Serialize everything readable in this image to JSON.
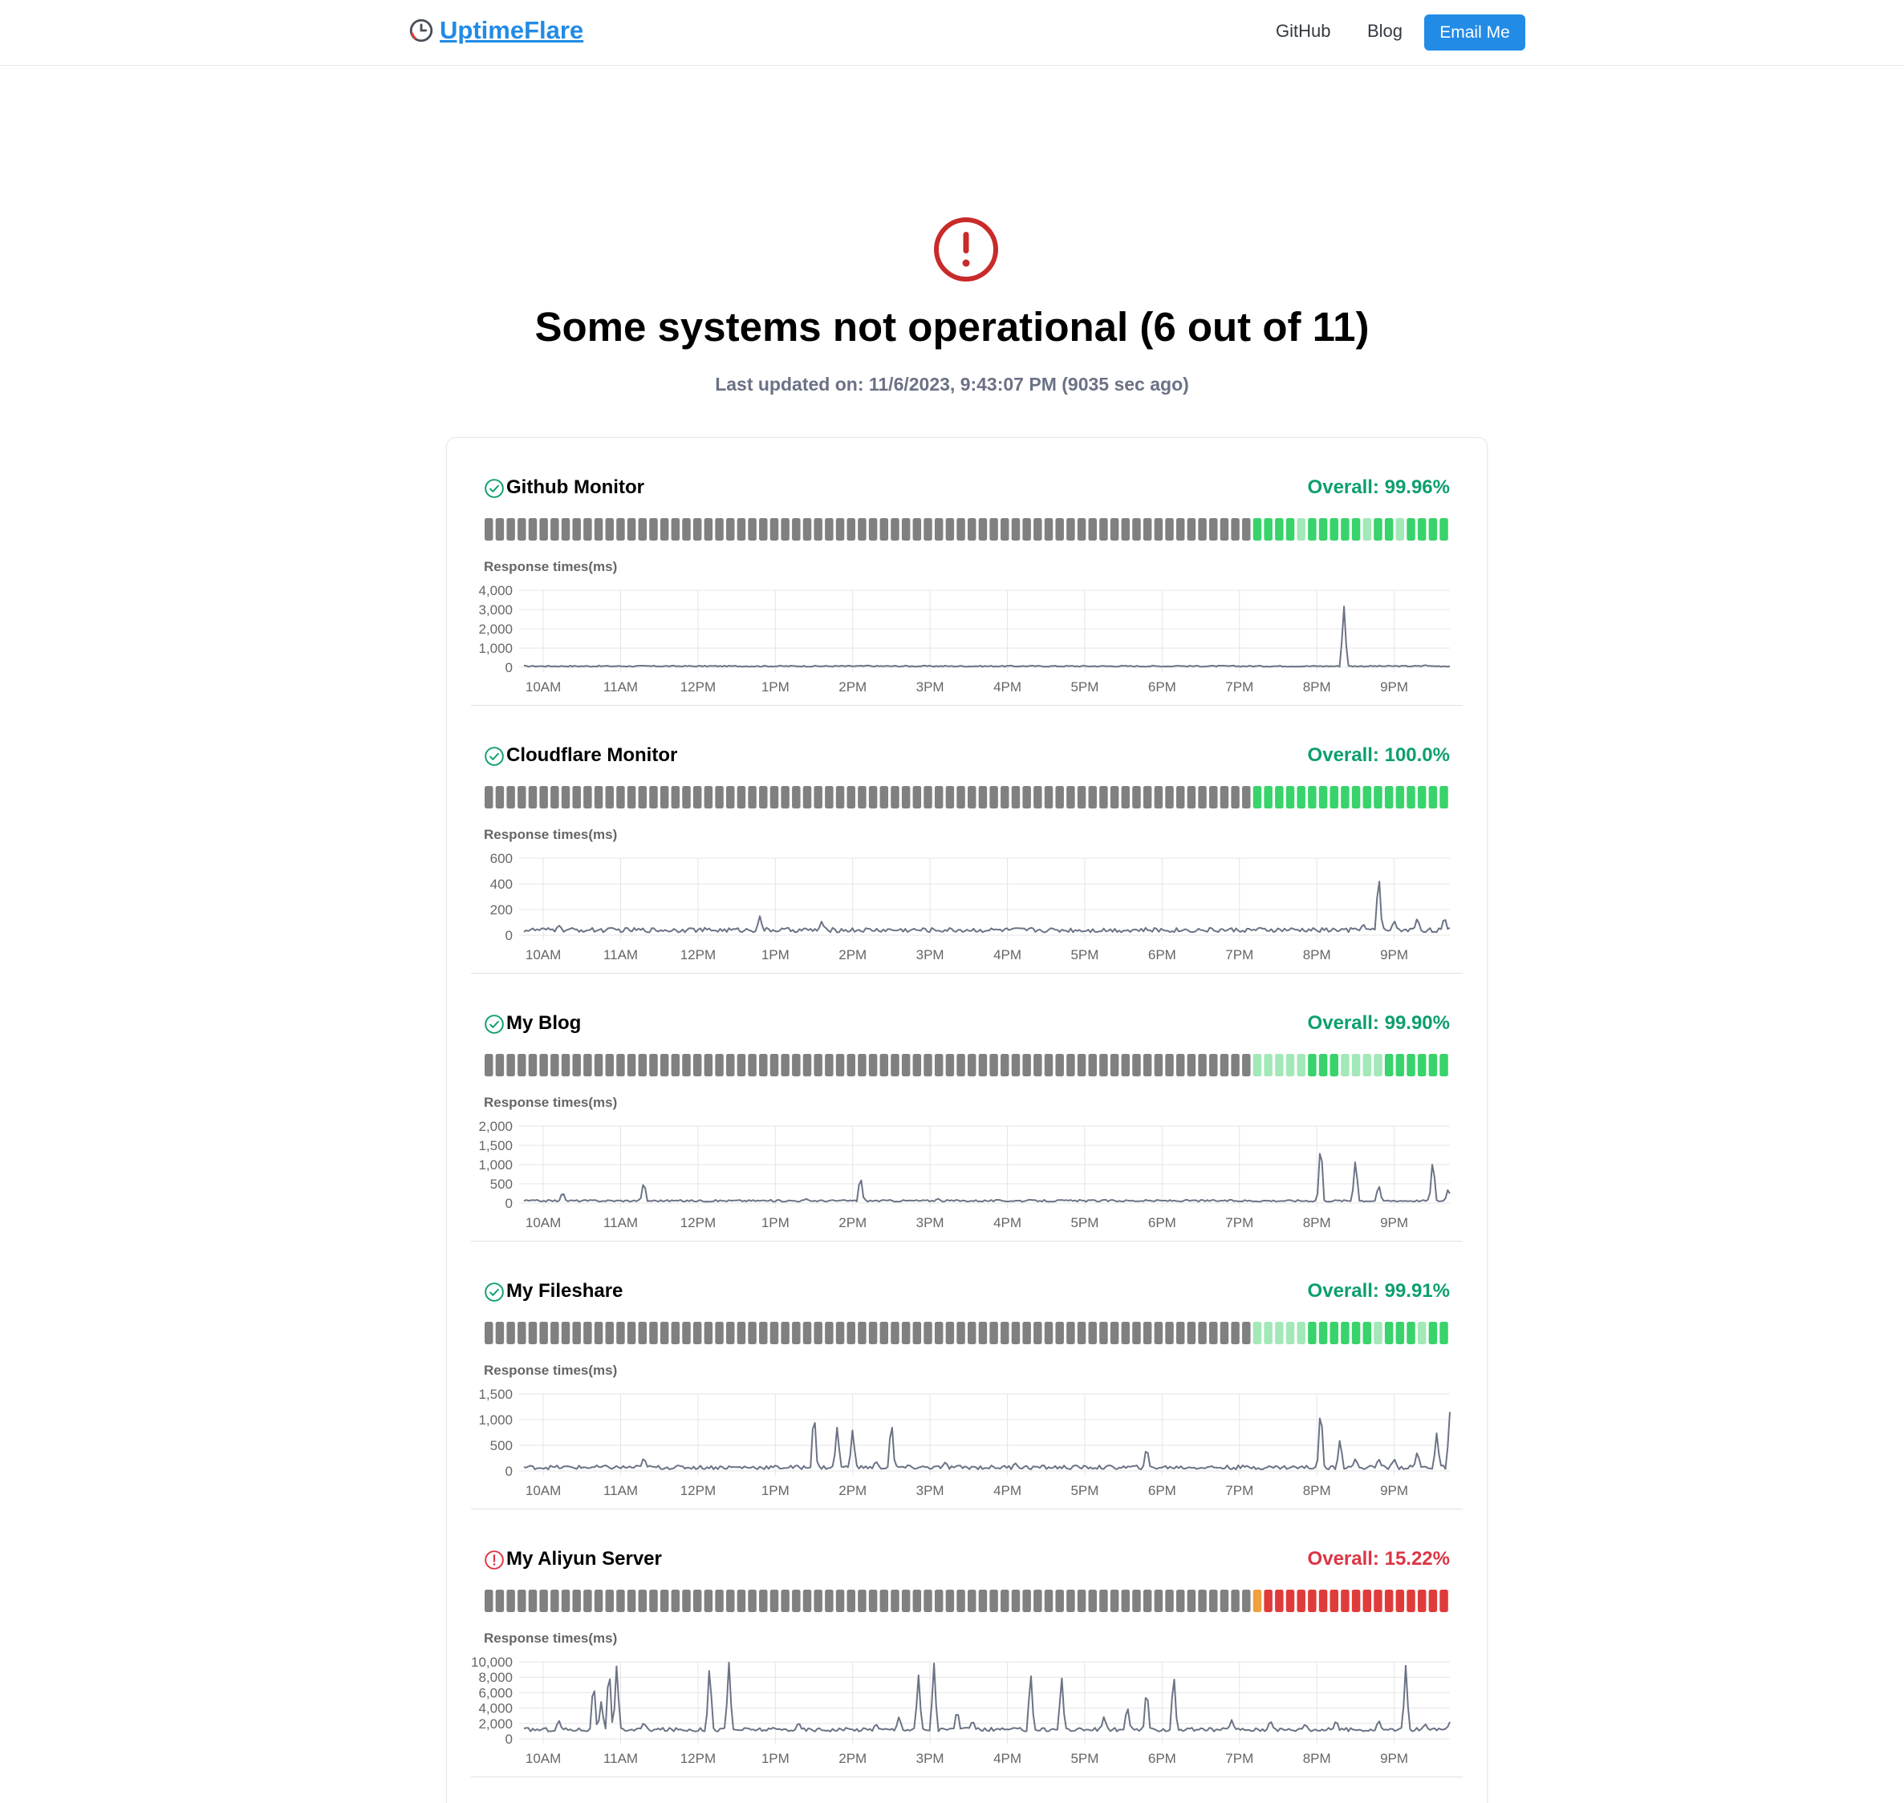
{
  "header": {
    "logo_text": "UptimeFlare",
    "nav_github": "GitHub",
    "nav_blog": "Blog",
    "nav_email": "Email Me"
  },
  "hero": {
    "title": "Some systems not operational (6 out of 11)",
    "subtitle": "Last updated on: 11/6/2023, 9:43:07 PM (9035 sec ago)"
  },
  "colors": {
    "link_blue": "#228be6",
    "ok_green": "#0d9f6e",
    "error_red": "#dc3545",
    "bar_grey": "#808080",
    "bar_green": "#38d36b",
    "bar_light_green": "#a3e8b8",
    "bar_orange": "#f0a03c",
    "bar_red": "#e03b3b",
    "line": "#6b7385"
  },
  "monitors": [
    {
      "name": "Github Monitor",
      "status": "up",
      "overall": "Overall: 99.96%",
      "bars": "GGGGGGGGGGGGGGGGGGGGGGGGGGGGGGGGGGGGGGGGGGGGGGGGGGGGGGGGGGGGGGGGGGGGGGGGGGGGGGGGGGGGGGGGGGGGGGGGGGGGGGGGGGGGGGGGGGGGGGGGGGGGGGGGGGGGGGGGGGGGGGGGGGGGGGGGGGGGGGGGGGGGGGGGGGGGGGGGGGGGGGGGGGGGGGGGGGG",
      "bar_states": [
        "g",
        "g",
        "g",
        "g",
        "g",
        "g",
        "g",
        "g",
        "g",
        "g",
        "g",
        "g",
        "g",
        "g",
        "g",
        "g",
        "g",
        "g",
        "g",
        "g",
        "g",
        "g",
        "g",
        "g",
        "g",
        "g",
        "g",
        "g",
        "g",
        "g",
        "g",
        "g",
        "g",
        "g",
        "g",
        "g",
        "g",
        "g",
        "g",
        "g",
        "g",
        "g",
        "g",
        "g",
        "g",
        "g",
        "g",
        "g",
        "g",
        "g",
        "g",
        "g",
        "g",
        "g",
        "g",
        "g",
        "g",
        "g",
        "g",
        "g",
        "g",
        "g",
        "g",
        "g",
        "g",
        "g",
        "g",
        "g",
        "g",
        "g",
        "G",
        "G",
        "G",
        "G",
        "L",
        "G",
        "G",
        "G",
        "G",
        "G",
        "L",
        "G",
        "G",
        "L",
        "G",
        "G",
        "G",
        "G"
      ],
      "chart_data": {
        "type": "line",
        "title": "Response times(ms)",
        "y_ticks": [
          "4,000",
          "3,000",
          "2,000",
          "1,000",
          "0"
        ],
        "ylim": [
          0,
          4000
        ],
        "x_ticks": [
          "10AM",
          "11AM",
          "12PM",
          "1PM",
          "2PM",
          "3PM",
          "4PM",
          "5PM",
          "6PM",
          "7PM",
          "8PM",
          "9PM"
        ],
        "x_range_hours": [
          9.75,
          21.72
        ],
        "baseline": 60,
        "noise": 30,
        "spikes": [
          [
            20.35,
            3300
          ],
          [
            18.2,
            90
          ],
          [
            14.2,
            100
          ],
          [
            21.4,
            120
          ]
        ]
      }
    },
    {
      "name": "Cloudflare Monitor",
      "status": "up",
      "overall": "Overall: 100.0%",
      "bar_states": [
        "g",
        "g",
        "g",
        "g",
        "g",
        "g",
        "g",
        "g",
        "g",
        "g",
        "g",
        "g",
        "g",
        "g",
        "g",
        "g",
        "g",
        "g",
        "g",
        "g",
        "g",
        "g",
        "g",
        "g",
        "g",
        "g",
        "g",
        "g",
        "g",
        "g",
        "g",
        "g",
        "g",
        "g",
        "g",
        "g",
        "g",
        "g",
        "g",
        "g",
        "g",
        "g",
        "g",
        "g",
        "g",
        "g",
        "g",
        "g",
        "g",
        "g",
        "g",
        "g",
        "g",
        "g",
        "g",
        "g",
        "g",
        "g",
        "g",
        "g",
        "g",
        "g",
        "g",
        "g",
        "g",
        "g",
        "g",
        "g",
        "g",
        "g",
        "G",
        "G",
        "G",
        "G",
        "G",
        "G",
        "G",
        "G",
        "G",
        "G",
        "G",
        "G",
        "G",
        "G",
        "G",
        "G",
        "G",
        "G"
      ],
      "chart_data": {
        "type": "line",
        "title": "Response times(ms)",
        "y_ticks": [
          "600",
          "400",
          "200",
          "0"
        ],
        "ylim": [
          0,
          600
        ],
        "x_ticks": [
          "10AM",
          "11AM",
          "12PM",
          "1PM",
          "2PM",
          "3PM",
          "4PM",
          "5PM",
          "6PM",
          "7PM",
          "8PM",
          "9PM"
        ],
        "x_range_hours": [
          9.75,
          21.72
        ],
        "baseline": 40,
        "noise": 18,
        "spikes": [
          [
            10.2,
            80
          ],
          [
            12.8,
            150
          ],
          [
            13.6,
            110
          ],
          [
            20.6,
            90
          ],
          [
            20.8,
            500
          ],
          [
            21.0,
            120
          ],
          [
            21.3,
            140
          ],
          [
            21.65,
            150
          ],
          [
            11.9,
            60
          ],
          [
            16.3,
            60
          ]
        ]
      }
    },
    {
      "name": "My Blog",
      "status": "up",
      "overall": "Overall: 99.90%",
      "bar_states": [
        "g",
        "g",
        "g",
        "g",
        "g",
        "g",
        "g",
        "g",
        "g",
        "g",
        "g",
        "g",
        "g",
        "g",
        "g",
        "g",
        "g",
        "g",
        "g",
        "g",
        "g",
        "g",
        "g",
        "g",
        "g",
        "g",
        "g",
        "g",
        "g",
        "g",
        "g",
        "g",
        "g",
        "g",
        "g",
        "g",
        "g",
        "g",
        "g",
        "g",
        "g",
        "g",
        "g",
        "g",
        "g",
        "g",
        "g",
        "g",
        "g",
        "g",
        "g",
        "g",
        "g",
        "g",
        "g",
        "g",
        "g",
        "g",
        "g",
        "g",
        "g",
        "g",
        "g",
        "g",
        "g",
        "g",
        "g",
        "g",
        "g",
        "g",
        "L",
        "L",
        "L",
        "L",
        "L",
        "G",
        "G",
        "G",
        "L",
        "L",
        "L",
        "L",
        "G",
        "G",
        "G",
        "G",
        "G",
        "G"
      ],
      "chart_data": {
        "type": "line",
        "title": "Response times(ms)",
        "y_ticks": [
          "2,000",
          "1,500",
          "1,000",
          "500",
          "0"
        ],
        "ylim": [
          0,
          2000
        ],
        "x_ticks": [
          "10AM",
          "11AM",
          "12PM",
          "1PM",
          "2PM",
          "3PM",
          "4PM",
          "5PM",
          "6PM",
          "7PM",
          "8PM",
          "9PM"
        ],
        "x_range_hours": [
          9.75,
          21.72
        ],
        "baseline": 60,
        "noise": 25,
        "spikes": [
          [
            10.25,
            300
          ],
          [
            11.3,
            600
          ],
          [
            14.1,
            750
          ],
          [
            20.05,
            1700
          ],
          [
            20.5,
            1200
          ],
          [
            20.8,
            500
          ],
          [
            21.5,
            1200
          ],
          [
            21.7,
            400
          ],
          [
            15.1,
            120
          ],
          [
            13.4,
            110
          ]
        ]
      }
    },
    {
      "name": "My Fileshare",
      "status": "up",
      "overall": "Overall: 99.91%",
      "bar_states": [
        "g",
        "g",
        "g",
        "g",
        "g",
        "g",
        "g",
        "g",
        "g",
        "g",
        "g",
        "g",
        "g",
        "g",
        "g",
        "g",
        "g",
        "g",
        "g",
        "g",
        "g",
        "g",
        "g",
        "g",
        "g",
        "g",
        "g",
        "g",
        "g",
        "g",
        "g",
        "g",
        "g",
        "g",
        "g",
        "g",
        "g",
        "g",
        "g",
        "g",
        "g",
        "g",
        "g",
        "g",
        "g",
        "g",
        "g",
        "g",
        "g",
        "g",
        "g",
        "g",
        "g",
        "g",
        "g",
        "g",
        "g",
        "g",
        "g",
        "g",
        "g",
        "g",
        "g",
        "g",
        "g",
        "g",
        "g",
        "g",
        "g",
        "g",
        "L",
        "L",
        "L",
        "L",
        "L",
        "G",
        "G",
        "G",
        "G",
        "G",
        "G",
        "L",
        "G",
        "G",
        "G",
        "L",
        "G",
        "G"
      ],
      "chart_data": {
        "type": "line",
        "title": "Response times(ms)",
        "y_ticks": [
          "1,500",
          "1,000",
          "500",
          "0"
        ],
        "ylim": [
          0,
          1500
        ],
        "x_ticks": [
          "10AM",
          "11AM",
          "12PM",
          "1PM",
          "2PM",
          "3PM",
          "4PM",
          "5PM",
          "6PM",
          "7PM",
          "8PM",
          "9PM"
        ],
        "x_range_hours": [
          9.75,
          21.72
        ],
        "baseline": 70,
        "noise": 40,
        "spikes": [
          [
            11.3,
            280
          ],
          [
            13.5,
            1250
          ],
          [
            13.8,
            900
          ],
          [
            14.0,
            850
          ],
          [
            14.5,
            1050
          ],
          [
            14.3,
            200
          ],
          [
            17.8,
            500
          ],
          [
            20.05,
            1350
          ],
          [
            20.3,
            650
          ],
          [
            21.3,
            400
          ],
          [
            21.55,
            750
          ],
          [
            21.72,
            1150
          ],
          [
            20.5,
            250
          ],
          [
            20.8,
            250
          ],
          [
            21.0,
            250
          ],
          [
            15.2,
            180
          ],
          [
            16.1,
            160
          ]
        ]
      }
    },
    {
      "name": "My Aliyun Server",
      "status": "down",
      "overall": "Overall: 15.22%",
      "bar_states": [
        "g",
        "g",
        "g",
        "g",
        "g",
        "g",
        "g",
        "g",
        "g",
        "g",
        "g",
        "g",
        "g",
        "g",
        "g",
        "g",
        "g",
        "g",
        "g",
        "g",
        "g",
        "g",
        "g",
        "g",
        "g",
        "g",
        "g",
        "g",
        "g",
        "g",
        "g",
        "g",
        "g",
        "g",
        "g",
        "g",
        "g",
        "g",
        "g",
        "g",
        "g",
        "g",
        "g",
        "g",
        "g",
        "g",
        "g",
        "g",
        "g",
        "g",
        "g",
        "g",
        "g",
        "g",
        "g",
        "g",
        "g",
        "g",
        "g",
        "g",
        "g",
        "g",
        "g",
        "g",
        "g",
        "g",
        "g",
        "g",
        "g",
        "g",
        "O",
        "R",
        "R",
        "R",
        "R",
        "R",
        "R",
        "R",
        "R",
        "R",
        "R",
        "R",
        "R",
        "R",
        "R",
        "R",
        "R",
        "R"
      ],
      "chart_data": {
        "type": "line",
        "title": "Response times(ms)",
        "y_ticks": [
          "10,000",
          "8,000",
          "6,000",
          "4,000",
          "2,000",
          "0"
        ],
        "ylim": [
          0,
          10000
        ],
        "x_ticks": [
          "10AM",
          "11AM",
          "12PM",
          "1PM",
          "2PM",
          "3PM",
          "4PM",
          "5PM",
          "6PM",
          "7PM",
          "8PM",
          "9PM"
        ],
        "x_range_hours": [
          9.75,
          21.72
        ],
        "baseline": 1200,
        "noise": 250,
        "spikes": [
          [
            10.2,
            2500
          ],
          [
            10.65,
            8000
          ],
          [
            10.75,
            5000
          ],
          [
            10.85,
            10000
          ],
          [
            10.95,
            10000
          ],
          [
            11.3,
            2200
          ],
          [
            12.15,
            10000
          ],
          [
            12.4,
            10000
          ],
          [
            13.3,
            2200
          ],
          [
            14.6,
            3000
          ],
          [
            14.85,
            8500
          ],
          [
            15.05,
            10000
          ],
          [
            15.35,
            4000
          ],
          [
            15.55,
            2500
          ],
          [
            16.3,
            9000
          ],
          [
            16.7,
            8500
          ],
          [
            17.25,
            3000
          ],
          [
            17.55,
            4500
          ],
          [
            17.8,
            7000
          ],
          [
            18.15,
            9000
          ],
          [
            18.9,
            2500
          ],
          [
            19.4,
            2500
          ],
          [
            20.25,
            2500
          ],
          [
            20.8,
            2500
          ],
          [
            21.15,
            9500
          ],
          [
            21.4,
            2000
          ],
          [
            21.72,
            2200
          ],
          [
            14.3,
            2000
          ],
          [
            19.85,
            2000
          ]
        ]
      }
    }
  ]
}
